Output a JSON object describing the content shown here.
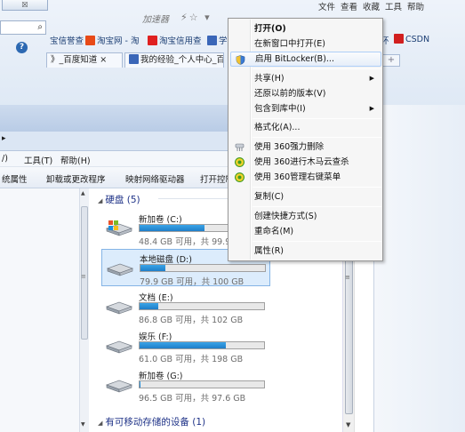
{
  "browser": {
    "close_glyph": "☒",
    "menu": [
      "文件",
      "查看",
      "收藏",
      "工具",
      "帮助"
    ],
    "speed_label": "加速器",
    "speed_icons": "⚡☆ ▾",
    "search_glyph": "⌕",
    "help_glyph": "?",
    "bookmarks": [
      {
        "label": "宝信誉查",
        "color": "#ffffff"
      },
      {
        "label": "淘宝网 - 淘",
        "color": "#e84a17"
      },
      {
        "label": "淘宝信用查",
        "color": "#e02020"
      },
      {
        "label": "学",
        "color": "#3a66b8"
      }
    ],
    "bookmarks_right": [
      {
        "label": "环",
        "color": "#ffffff"
      },
      {
        "label": "CSDN",
        "color": "#d11f1f"
      },
      {
        "label": "",
        "color": "#ffffff"
      }
    ],
    "tabs": [
      {
        "label": "》_百度知道  ×"
      },
      {
        "label": "我的经验_个人中心_百度"
      }
    ],
    "add_tab": "+"
  },
  "explorer": {
    "address_partial": "▸",
    "menubar": [
      "/)",
      "工具(T)",
      "帮助(H)"
    ],
    "toolbar": [
      "统属性",
      "卸载或更改程序",
      "映射网络驱动器",
      "打开控制"
    ],
    "section_hard_disk": "硬盘 (5)",
    "section_removable": "有可移动存储的设备 (1)",
    "drives": [
      {
        "name": "新加卷 (C:)",
        "info": "48.4 GB 可用，共 99.9 G",
        "used_fraction": 0.52,
        "selected": false
      },
      {
        "name": "本地磁盘 (D:)",
        "info": "79.9 GB 可用，共 100 GB",
        "used_fraction": 0.2,
        "selected": true
      },
      {
        "name": "文档 (E:)",
        "info": "86.8 GB 可用，共 102 GB",
        "used_fraction": 0.15,
        "selected": false
      },
      {
        "name": "娱乐 (F:)",
        "info": "61.0 GB 可用，共 198 GB",
        "used_fraction": 0.69,
        "selected": false
      },
      {
        "name": "新加卷 (G:)",
        "info": "96.5 GB 可用，共 97.6 GB",
        "used_fraction": 0.01,
        "selected": false
      }
    ]
  },
  "context_menu": {
    "items": [
      {
        "label": "打开(O)",
        "bold": true
      },
      {
        "label": "在新窗口中打开(E)"
      },
      {
        "label": "启用 BitLocker(B)...",
        "highlighted": true,
        "icon": "shield-icon"
      },
      {
        "label": "共享(H)",
        "submenu": true
      },
      {
        "label": "还原以前的版本(V)"
      },
      {
        "label": "包含到库中(I)",
        "submenu": true
      },
      {
        "label": "格式化(A)..."
      },
      {
        "label": "使用 360强力删除",
        "icon": "shredder-icon"
      },
      {
        "label": "使用 360进行木马云查杀",
        "icon": "360-icon"
      },
      {
        "label": "使用 360管理右键菜单",
        "icon": "360-icon"
      },
      {
        "label": "复制(C)"
      },
      {
        "label": "创建快捷方式(S)"
      },
      {
        "label": "重命名(M)"
      },
      {
        "label": "属性(R)"
      }
    ]
  },
  "colors": {
    "accent": "#1e3287",
    "selection": "#dcecfc",
    "drive_bar": "#1f7ec8"
  }
}
